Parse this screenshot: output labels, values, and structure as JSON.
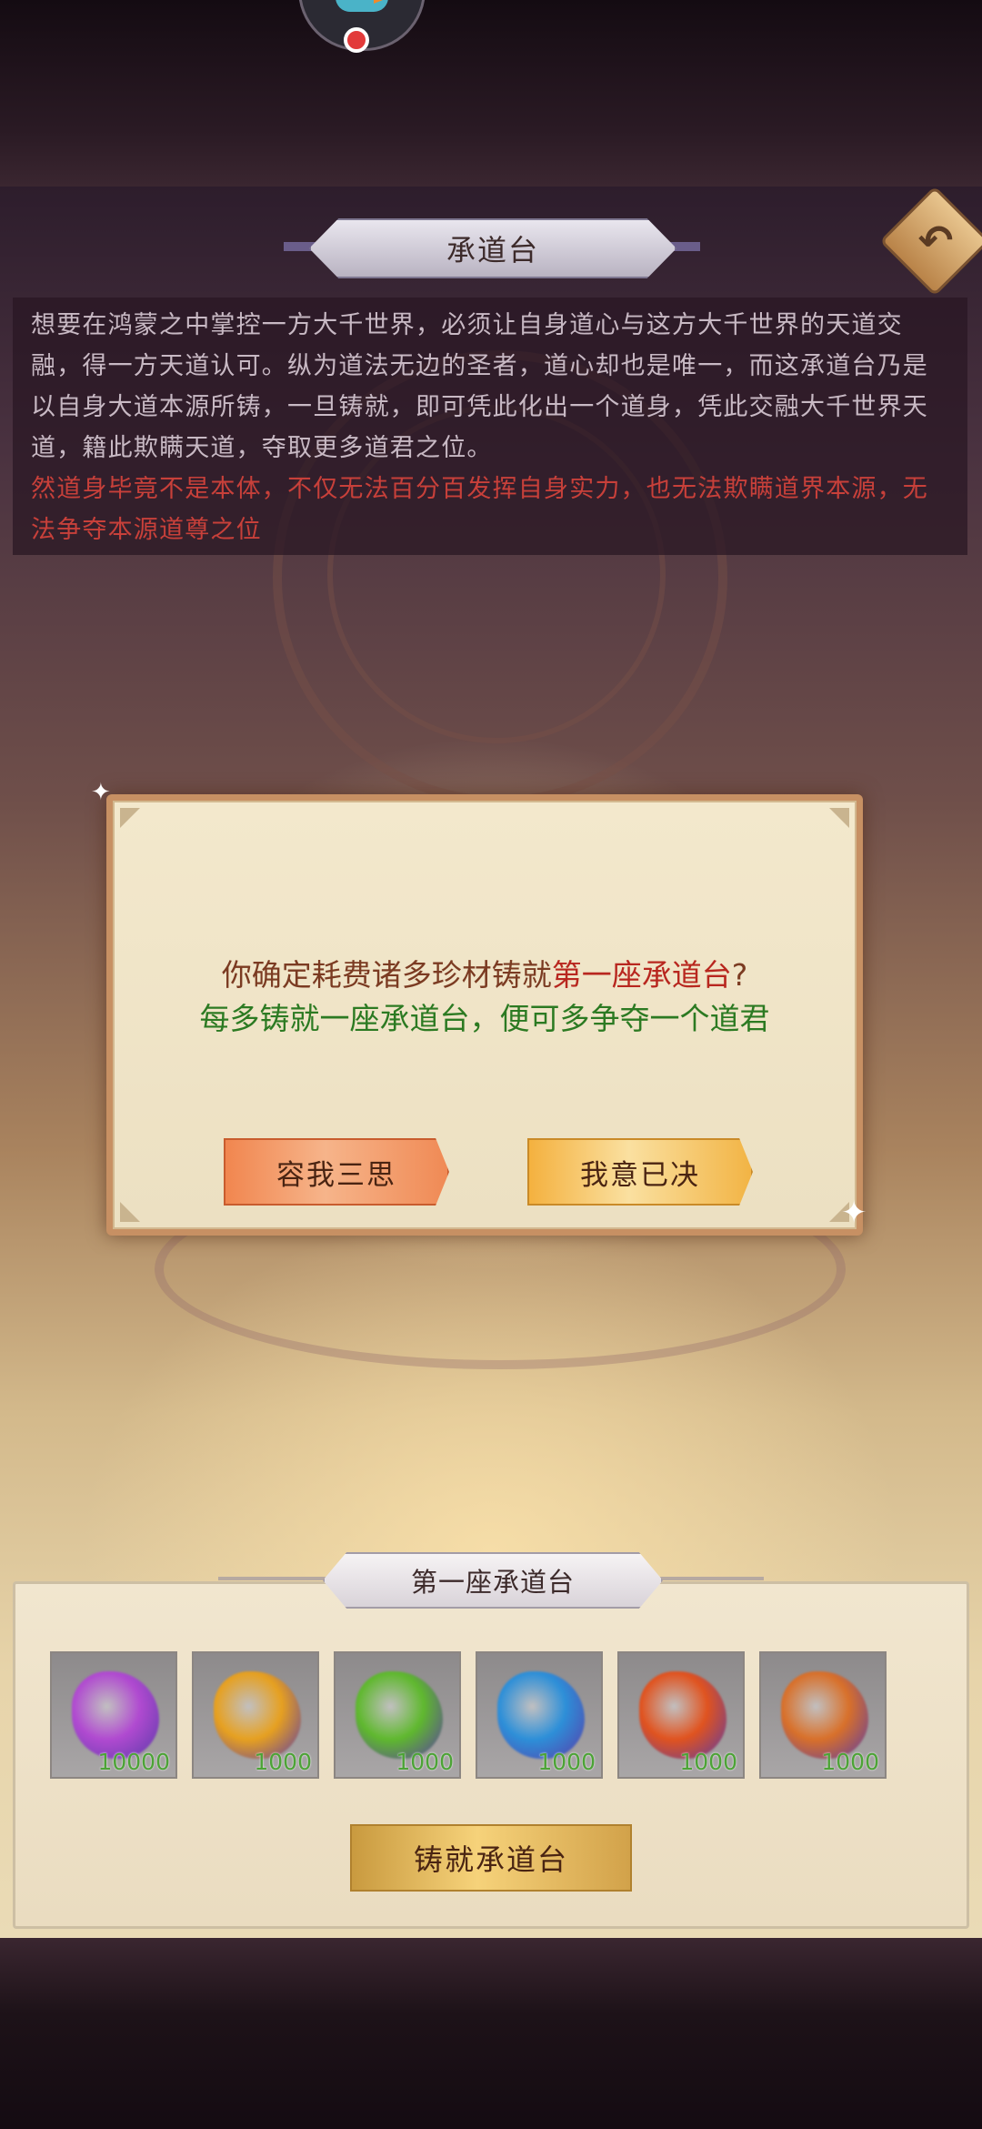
{
  "header": {
    "title": "承道台"
  },
  "description": {
    "paragraph": "想要在鸿蒙之中掌控一方大千世界，必须让自身道心与这方大千世界的天道交融，得一方天道认可。纵为道法无边的圣者，道心却也是唯一，而这承道台乃是以自身大道本源所铸，一旦铸就，即可凭此化出一个道身，凭此交融大千世界天道，籍此欺瞒天道，夺取更多道君之位。",
    "warning": "然道身毕竟不是本体，不仅无法百分百发挥自身实力，也无法欺瞒道界本源，无法争夺本源道尊之位"
  },
  "dialog": {
    "question_prefix": "你确定耗费诸多珍材铸就",
    "question_highlight": "第一座承道台",
    "question_suffix": "?",
    "subtitle": "每多铸就一座承道台，便可多争夺一个道君",
    "cancel_label": "容我三思",
    "confirm_label": "我意已决"
  },
  "panel": {
    "title": "第一座承道台",
    "forge_label": "铸就承道台",
    "items": [
      {
        "icon": "purple-crystal-icon",
        "color": "#b04ad0",
        "qty": "10000"
      },
      {
        "icon": "gold-crystal-icon",
        "color": "#e6a020",
        "qty": "1000"
      },
      {
        "icon": "green-crystal-icon",
        "color": "#5fb82e",
        "qty": "1000"
      },
      {
        "icon": "blue-crystal-icon",
        "color": "#2d8fd8",
        "qty": "1000"
      },
      {
        "icon": "red-crystal-icon",
        "color": "#e0531f",
        "qty": "1000"
      },
      {
        "icon": "orange-crystal-icon",
        "color": "#d8702a",
        "qty": "1000"
      }
    ]
  },
  "colors": {
    "warning": "#c8403a",
    "highlight": "#b8271f",
    "subtitle": "#2c7a22",
    "quantity": "#4ca336"
  }
}
